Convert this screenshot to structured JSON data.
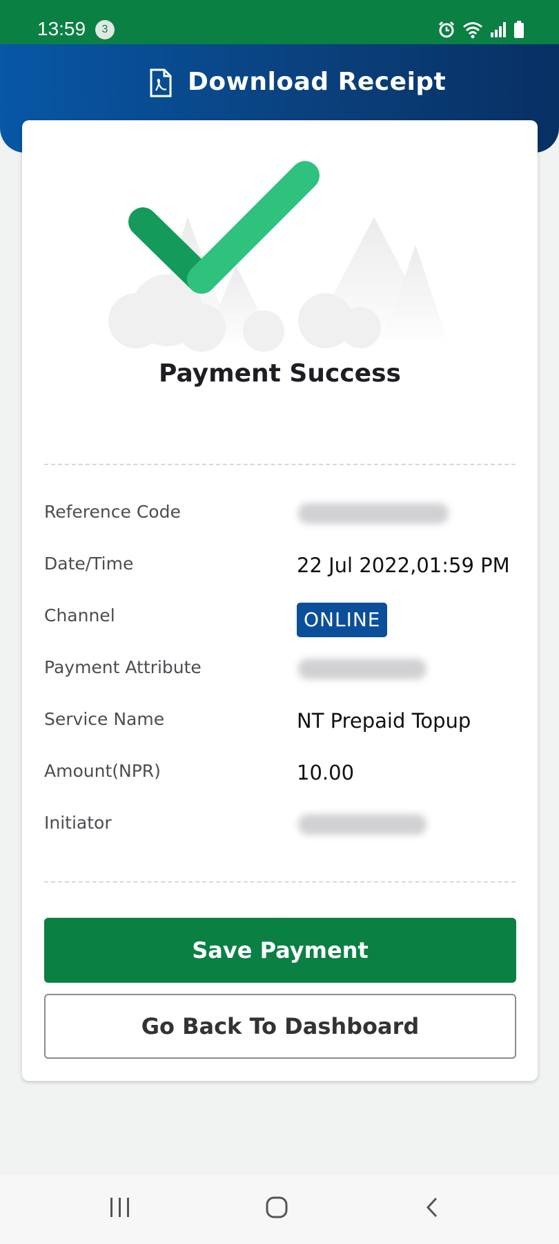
{
  "status_bar": {
    "time": "13:59",
    "notification_count": "3",
    "icons": [
      "alarm-icon",
      "wifi-icon",
      "signal-icon",
      "battery-icon"
    ]
  },
  "header": {
    "title": "Download Receipt",
    "icon": "pdf-file-icon"
  },
  "receipt": {
    "title": "Payment Success",
    "rows": [
      {
        "label": "Reference Code",
        "value": "",
        "blurred": true
      },
      {
        "label": "Date/Time",
        "value": "22 Jul 2022,01:59 PM",
        "blurred": false
      },
      {
        "label": "Channel",
        "value": "ONLINE",
        "badge": true
      },
      {
        "label": "Payment Attribute",
        "value": "",
        "blurred": true
      },
      {
        "label": "Service Name",
        "value": "NT Prepaid Topup",
        "blurred": false
      },
      {
        "label": "Amount(NPR)",
        "value": "10.00",
        "blurred": false
      },
      {
        "label": "Initiator",
        "value": "",
        "blurred": true
      }
    ]
  },
  "actions": {
    "save_label": "Save Payment",
    "back_label": "Go Back To Dashboard"
  },
  "colors": {
    "primary_green": "#0a8043",
    "header_blue": "#0757a6",
    "badge_blue": "#0b4f9a",
    "check_green": "#2ec27e"
  },
  "nav_bar": [
    "recent-apps-icon",
    "home-icon",
    "back-icon"
  ]
}
